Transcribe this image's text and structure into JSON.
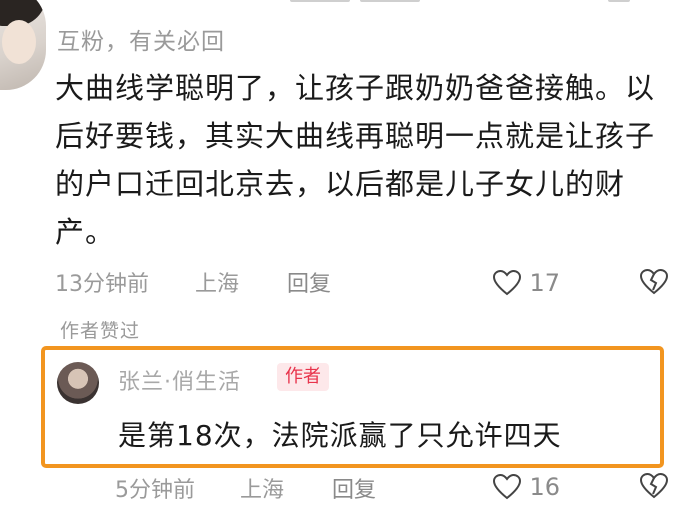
{
  "comment": {
    "author": "互粉，有关必回",
    "text": "大曲线学聪明了，让孩子跟奶奶爸爸接触。以后好要钱，其实大曲线再聪明一点就是让孩子的户口迁回北京去，以后都是儿子女儿的财产。",
    "time": "13分钟前",
    "location": "上海",
    "reply_label": "回复",
    "like_count": "17",
    "author_liked": "作者赞过"
  },
  "reply": {
    "author": "张兰·俏生活",
    "badge": "作者",
    "text": "是第18次，法院派赢了只允许四天",
    "time": "5分钟前",
    "location": "上海",
    "reply_label": "回复",
    "like_count": "16"
  },
  "icons": {
    "like": "heart-outline-icon",
    "dislike": "broken-heart-icon"
  }
}
